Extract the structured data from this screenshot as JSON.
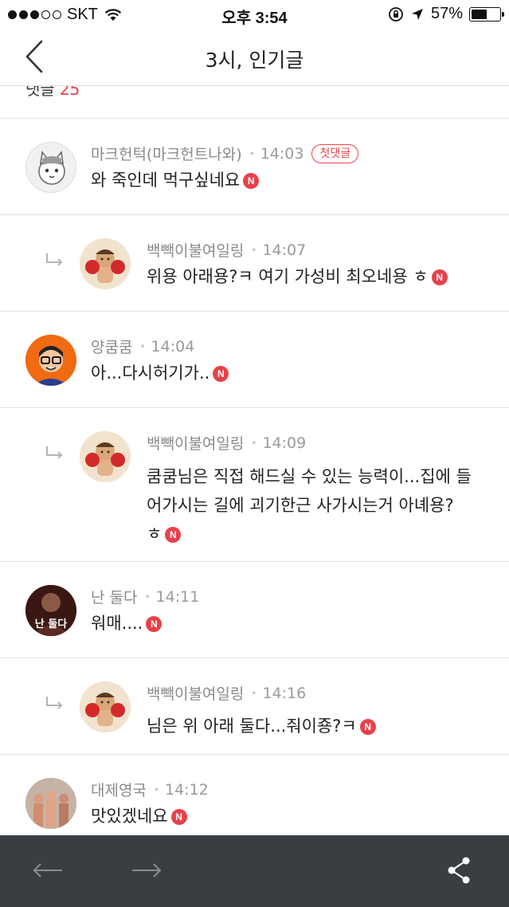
{
  "status_bar": {
    "carrier": "SKT",
    "time": "오후 3:54",
    "battery": "57%",
    "battery_level": 0.57
  },
  "header": {
    "title": "3시, 인기글"
  },
  "peek": {
    "label": "댓글",
    "count": "25"
  },
  "comments": [
    {
      "author": "마크헌턱(마크헌트나와)",
      "time": "14:03",
      "badge": "첫댓글",
      "text": "와 죽인데 먹구싶네요",
      "new_badge": "N",
      "reply": false,
      "avatar": "cat-avatar"
    },
    {
      "author": "백빽이불여일링",
      "time": "14:07",
      "text": "위용 아래용?ㅋ 여기 가성비 최오네용 ㅎ",
      "new_badge": "N",
      "reply": true,
      "avatar": "boxer-avatar"
    },
    {
      "author": "양쿰쿰",
      "time": "14:04",
      "text": "아...다시허기가..",
      "new_badge": "N",
      "reply": false,
      "avatar": "glasses-man-avatar"
    },
    {
      "author": "백빽이불여일링",
      "time": "14:09",
      "text_lines": [
        "쿰쿰님은 직접 해드실 수 있는 능력이...집에 들",
        "어가시는 길에 괴기한근 사가시는거 아녜용?",
        "ㅎ"
      ],
      "new_badge": "N",
      "reply": true,
      "avatar": "boxer-avatar"
    },
    {
      "author": "난 둘다",
      "time": "14:11",
      "text": "워매....",
      "new_badge": "N",
      "reply": false,
      "avatar": "dark-photo-avatar",
      "avatar_text": "난 둘다"
    },
    {
      "author": "백빽이불여일링",
      "time": "14:16",
      "text": "님은 위 아래 둘다...줘이죵?ㅋ",
      "new_badge": "N",
      "reply": true,
      "avatar": "boxer-avatar"
    },
    {
      "author": "대제영국",
      "time": "14:12",
      "text": "맛있겠네요",
      "new_badge": "N",
      "reply": false,
      "avatar": "crowd-photo-avatar"
    }
  ],
  "toolbar": {
    "back_icon": "arrow-left-icon",
    "forward_icon": "arrow-right-icon",
    "share_icon": "share-icon"
  },
  "colors": {
    "accent": "#e8414a",
    "toolbar_bg": "#3a3d42",
    "text": "#222222",
    "meta": "#8a8a8a"
  }
}
